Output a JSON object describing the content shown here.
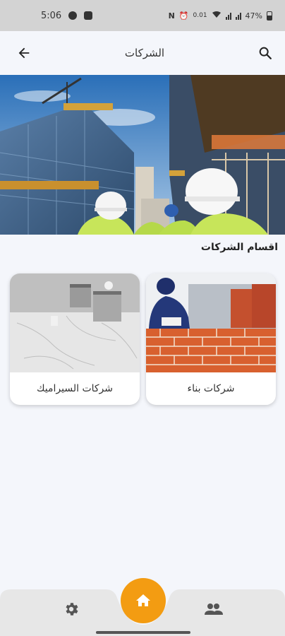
{
  "status_bar": {
    "time": "5:06",
    "battery": "47%",
    "data_rate": "0.01"
  },
  "app_bar": {
    "title": "الشركات",
    "back_icon": "arrow-left-icon",
    "search_icon": "search-icon"
  },
  "hero": {
    "image": "construction-site-photo"
  },
  "section": {
    "title": "اقسام الشركات"
  },
  "categories": [
    {
      "label": "شركات بناء",
      "image": "bricklayer-photo"
    },
    {
      "label": "شركات السيراميك",
      "image": "marble-floor-photo"
    }
  ],
  "bottom_nav": {
    "left_icon": "gear-icon",
    "center_icon": "home-icon",
    "right_icon": "people-icon",
    "accent_color": "#f39c12"
  }
}
